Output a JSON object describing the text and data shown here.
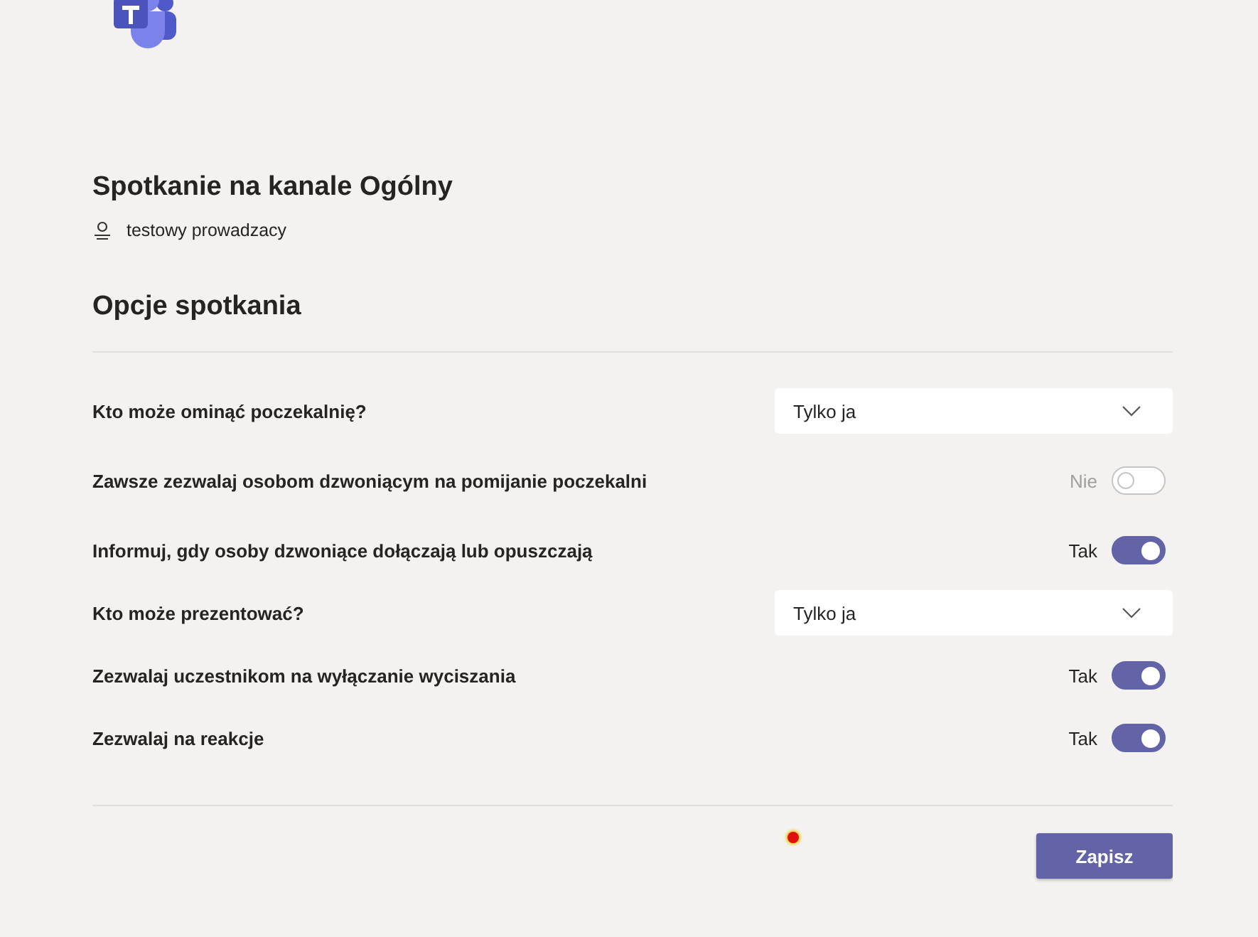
{
  "meeting": {
    "title": "Spotkanie na kanale Ogólny",
    "organizer": "testowy prowadzacy"
  },
  "section_title": "Opcje spotkania",
  "options": [
    {
      "kind": "dropdown",
      "label": "Kto może ominąć poczekalnię?",
      "value": "Tylko ja"
    },
    {
      "kind": "toggle",
      "label": "Zawsze zezwalaj osobom dzwoniącym na pomijanie poczekalni",
      "state_label": "Nie",
      "on": false,
      "disabled": true
    },
    {
      "kind": "toggle",
      "label": "Informuj, gdy osoby dzwoniące dołączają lub opuszczają",
      "state_label": "Tak",
      "on": true,
      "disabled": false
    },
    {
      "kind": "dropdown",
      "label": "Kto może prezentować?",
      "value": "Tylko ja"
    },
    {
      "kind": "toggle",
      "label": "Zezwalaj uczestnikom na wyłączanie wyciszania",
      "state_label": "Tak",
      "on": true,
      "disabled": false
    },
    {
      "kind": "toggle",
      "label": "Zezwalaj na reakcje",
      "state_label": "Tak",
      "on": true,
      "disabled": false
    }
  ],
  "save_button": "Zapisz"
}
